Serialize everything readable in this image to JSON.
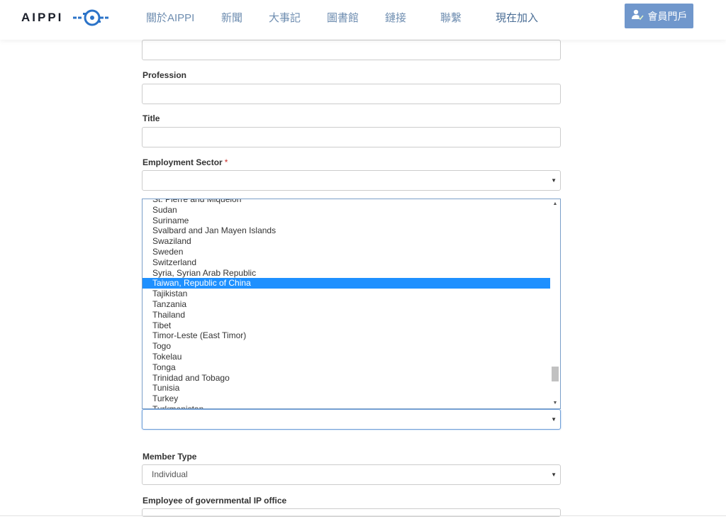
{
  "header": {
    "logo_text": "AIPPI",
    "nav": [
      {
        "label": "關於AIPPI"
      },
      {
        "label": "新聞"
      },
      {
        "label": "大事記"
      },
      {
        "label": "圖書館"
      },
      {
        "label": "鏈接"
      },
      {
        "label": "聯繫"
      },
      {
        "label": "現在加入"
      }
    ],
    "portal_button": "會員門戶"
  },
  "form": {
    "profession_label": "Profession",
    "title_label": "Title",
    "employment_sector_label": "Employment Sector",
    "required_mark": "*",
    "employment_sector_value": "",
    "country_value": "",
    "member_type_label": "Member Type",
    "member_type_value": "Individual",
    "employee_gov_label": "Employee of governmental IP office"
  },
  "dropdown": {
    "options": [
      "St. Pierre and Miquelon",
      "Sudan",
      "Suriname",
      "Svalbard and Jan Mayen Islands",
      "Swaziland",
      "Sweden",
      "Switzerland",
      "Syria, Syrian Arab Republic",
      "Taiwan, Republic of China",
      "Tajikistan",
      "Tanzania",
      "Thailand",
      "Tibet",
      "Timor-Leste (East Timor)",
      "Togo",
      "Tokelau",
      "Tonga",
      "Trinidad and Tobago",
      "Tunisia",
      "Turkey",
      "Turkmenistan"
    ],
    "selected": "Taiwan, Republic of China"
  },
  "colors": {
    "accent": "#1e90ff",
    "nav_text": "#6e8db0",
    "portal_button_bg": "#7097cc"
  },
  "icons": {
    "logo_mark": "aippi-logo-mark",
    "portal": "user-check-icon",
    "caret": "caret-down-icon"
  }
}
